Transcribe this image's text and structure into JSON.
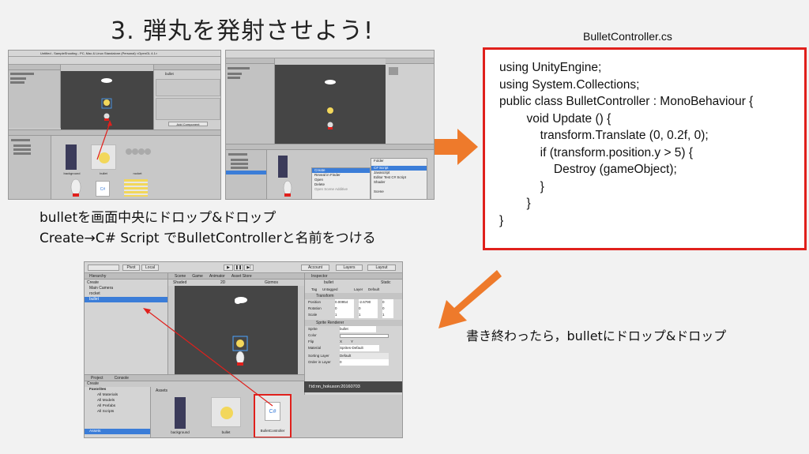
{
  "slide": {
    "title": "3. 弾丸を発射させよう!",
    "code_filename": "BulletController.cs",
    "code_lines": [
      "using UnityEngine;",
      "using System.Collections;",
      "public class BulletController : MonoBehaviour {",
      "        void Update () {",
      "            transform.Translate (0, 0.2f, 0);",
      "            if (transform.position.y > 5) {",
      "                Destroy (gameObject);",
      "            }",
      "        }",
      "}"
    ],
    "caption_left_1": "bulletを画面中央にドロップ&ドロップ",
    "caption_left_2": "Create→C# Script でBulletControllerと名前をつける",
    "caption_right": "書き終わったら，bulletにドロップ&ドロップ",
    "watermark": "f:id:nn_hokuson:20160703"
  },
  "shot_bottom": {
    "toolbar": {
      "pivot": "Pivot",
      "local": "Local",
      "account": "Account",
      "layers": "Layers",
      "layout": "Layout"
    },
    "hierarchy": {
      "tab": "Hierarchy",
      "create": "Create",
      "items": [
        "Main Camera",
        "rocket",
        "bullet"
      ]
    },
    "scene_tabs": [
      "Scene",
      "Game",
      "Animator",
      "Asset Store"
    ],
    "scene_shaded": "Shaded",
    "scene_2d": "2D",
    "scene_gizmos": "Gizmos",
    "inspector": {
      "tab": "Inspector",
      "object_name": "bullet",
      "static": "Static",
      "tag_label": "Tag",
      "tag_value": "Untagged",
      "layer_label": "Layer",
      "layer_value": "Default",
      "transform": "Transform",
      "position": {
        "label": "Position",
        "x": "0.00954",
        "y": "-2.6790",
        "z": "0"
      },
      "rotation": {
        "label": "Rotation",
        "x": "0",
        "y": "0",
        "z": "0"
      },
      "scale": {
        "label": "Scale",
        "x": "1",
        "y": "1",
        "z": "1"
      },
      "sprite_renderer": "Sprite Renderer",
      "sprite": {
        "label": "Sprite",
        "value": "bullet"
      },
      "color": {
        "label": "Color"
      },
      "flip": {
        "label": "Flip",
        "x": "X",
        "y": "Y"
      },
      "material": {
        "label": "Material",
        "value": "Sprites-Default"
      },
      "sorting_layer": {
        "label": "Sorting Layer",
        "value": "Default"
      },
      "order_in_layer": {
        "label": "Order in Layer",
        "value": "0"
      }
    },
    "project": {
      "tab_project": "Project",
      "tab_console": "Console",
      "create": "Create",
      "favorites": "Favorites",
      "favorites_items": [
        "All Materials",
        "All Models",
        "All Prefabs",
        "All Scripts"
      ],
      "assets_label": "Assets",
      "assets_tree": "Assets",
      "assets": [
        "background",
        "bullet",
        "BulletController"
      ]
    }
  },
  "shot_topleft": {
    "title": "Untitled - SampleShooting - PC, Mac & Linux Standalone (Personal) <OpenGL 4.1>",
    "object_name": "bullet",
    "add_component": "Add Component",
    "assets": [
      "background",
      "bullet",
      "rocket"
    ]
  },
  "shot_topright": {
    "menu_left": [
      "Create",
      "Reveal in Finder",
      "Open",
      "Delete",
      "Open Scene Additive"
    ],
    "menu_right": [
      "Folder",
      "C# Script",
      "Javascript",
      "Editor Test C# Script",
      "Shader",
      "Scene"
    ],
    "selected_left": "Create",
    "selected_right": "C# Script"
  },
  "colors": {
    "code_border": "#e0201c",
    "arrow": "#ee7a2b",
    "selection": "#3b7dd8",
    "red_line": "#e0201c"
  }
}
